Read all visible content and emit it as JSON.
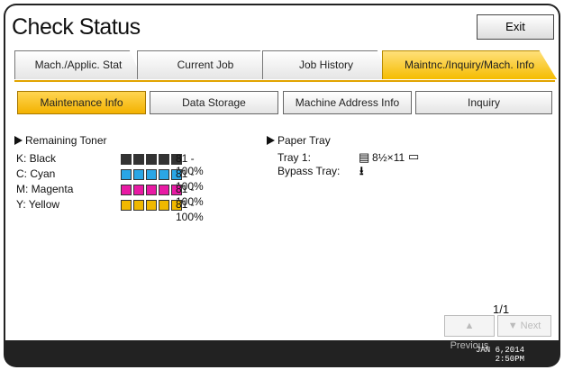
{
  "header": {
    "title": "Check Status",
    "exit_label": "Exit"
  },
  "tabs": [
    {
      "label": "Mach./Applic. Stat"
    },
    {
      "label": "Current Job"
    },
    {
      "label": "Job History"
    },
    {
      "label": "Maintnc./Inquiry/Mach. Info"
    }
  ],
  "subtabs": [
    {
      "label": "Maintenance Info"
    },
    {
      "label": "Data Storage"
    },
    {
      "label": "Machine Address Info"
    },
    {
      "label": "Inquiry"
    }
  ],
  "toner": {
    "title": "Remaining Toner",
    "items": [
      {
        "label": "K: Black",
        "percent": "81 - 100%",
        "color": "#333333",
        "level": 1.0
      },
      {
        "label": "C: Cyan",
        "percent": "81 - 100%",
        "color": "#2aa6e6",
        "level": 1.0
      },
      {
        "label": "M: Magenta",
        "percent": "81 - 100%",
        "color": "#e81aa4",
        "level": 1.0
      },
      {
        "label": "Y: Yellow",
        "percent": "81 - 100%",
        "color": "#f0b800",
        "level": 1.0
      }
    ]
  },
  "paper": {
    "title": "Paper Tray",
    "tray1_label": "Tray 1:",
    "tray1_value": "8½×11",
    "bypass_label": "Bypass Tray:"
  },
  "pager": {
    "page": "1/1",
    "previous": "Previous",
    "next": "Next"
  },
  "footer": {
    "date": "JAN   6,2014",
    "time": "2:50PM"
  }
}
